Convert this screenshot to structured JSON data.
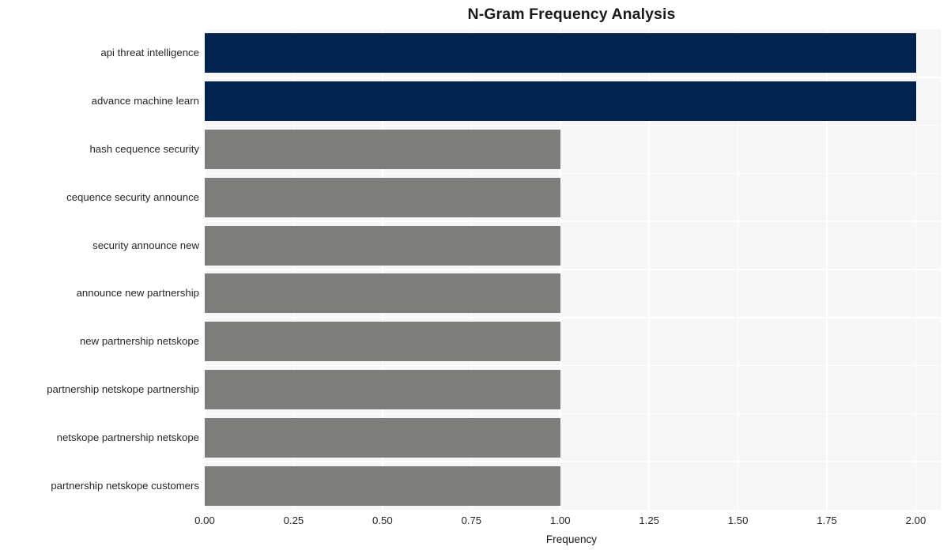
{
  "chart_data": {
    "type": "bar",
    "orientation": "horizontal",
    "title": "N-Gram Frequency Analysis",
    "xlabel": "Frequency",
    "ylabel": "",
    "xlim": [
      0,
      2.07
    ],
    "xticks": [
      "0.00",
      "0.25",
      "0.50",
      "0.75",
      "1.00",
      "1.25",
      "1.50",
      "1.75",
      "2.00"
    ],
    "xtick_values": [
      0,
      0.25,
      0.5,
      0.75,
      1.0,
      1.25,
      1.5,
      1.75,
      2.0
    ],
    "grid": true,
    "legend": "none",
    "categories": [
      "api threat intelligence",
      "advance machine learn",
      "hash cequence security",
      "cequence security announce",
      "security announce new",
      "announce new partnership",
      "new partnership netskope",
      "partnership netskope partnership",
      "netskope partnership netskope",
      "partnership netskope customers"
    ],
    "values": [
      2,
      2,
      1,
      1,
      1,
      1,
      1,
      1,
      1,
      1
    ],
    "bar_colors": [
      "#00244f",
      "#00244f",
      "#7d7d7b",
      "#7d7d7b",
      "#7d7d7b",
      "#7d7d7b",
      "#7d7d7b",
      "#7d7d7b",
      "#7d7d7b",
      "#7d7d7b"
    ],
    "colors": {
      "highlight": "#00244f",
      "base": "#7d7d7b",
      "plot_background": "#f6f6f7",
      "figure_background": "#ffffff",
      "grid": "#ffffff",
      "text": "#262626"
    }
  }
}
